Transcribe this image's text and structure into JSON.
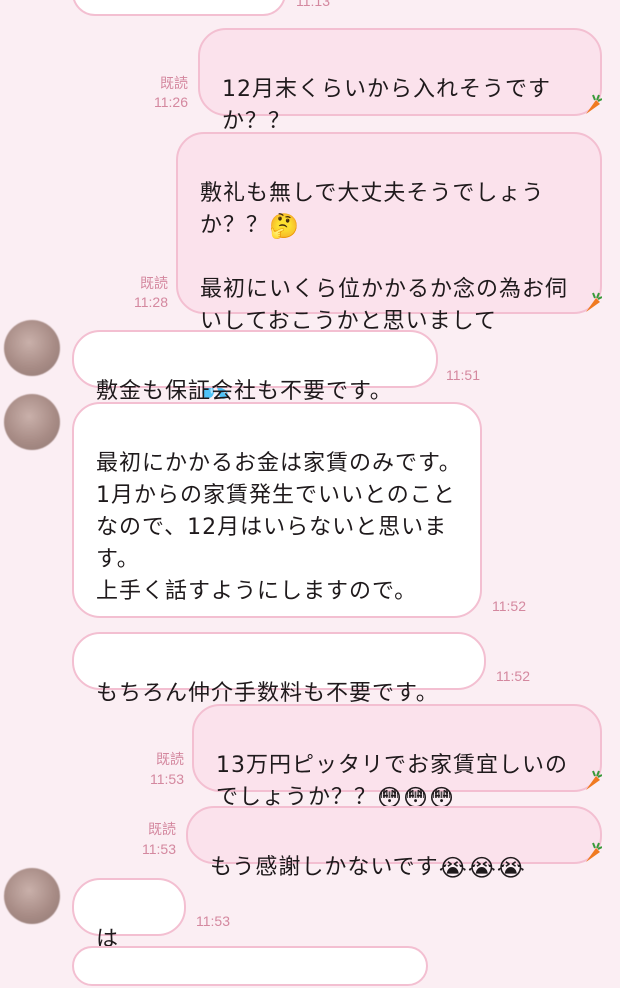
{
  "messages": [
    {
      "id": "top-partial",
      "side": "out",
      "text": "",
      "time": "11:13",
      "read": ""
    },
    {
      "id": "m1",
      "side": "out",
      "text": "12月末くらいから入れそうですか？？",
      "read": "既読",
      "time": "11:26"
    },
    {
      "id": "m2",
      "side": "out",
      "text": "敷礼も無しで大丈夫そうでしょうか？？",
      "emoji_a": "🤔",
      "text_b": "最初にいくら位かかるか念の為お伺いしておこうかと思いまして",
      "emoji_b": "💦",
      "read": "既読",
      "time": "11:28"
    },
    {
      "id": "m3",
      "side": "in",
      "text": "敷金も保証会社も不要です。",
      "time": "11:51"
    },
    {
      "id": "m4",
      "side": "in",
      "text": "最初にかかるお金は家賃のみです。\n1月からの家賃発生でいいとのことなので、12月はいらないと思います。\n上手く話すようにしますので。",
      "time": "11:52"
    },
    {
      "id": "m5",
      "side": "in",
      "text": "もちろん仲介手数料も不要です。",
      "time": "11:52"
    },
    {
      "id": "m6",
      "side": "out",
      "text": "13万円ピッタリでお家賃宜しいのでしょうか？？",
      "emoji": "😳😳😳",
      "read": "既読",
      "time": "11:53"
    },
    {
      "id": "m7",
      "side": "out",
      "text": "もう感謝しかないです",
      "emoji": "😭😭😭",
      "read": "既読",
      "time": "11:53"
    },
    {
      "id": "m8",
      "side": "in",
      "text": "はい。",
      "time": "11:53"
    }
  ],
  "icons": {
    "avatar": "avatar-image",
    "carrot": "carrot-icon"
  },
  "colors": {
    "background": "#fbeef3",
    "out_bubble": "#fbe2ec",
    "in_bubble": "#ffffff",
    "border": "#f3bfd1",
    "meta": "#d4889f"
  }
}
